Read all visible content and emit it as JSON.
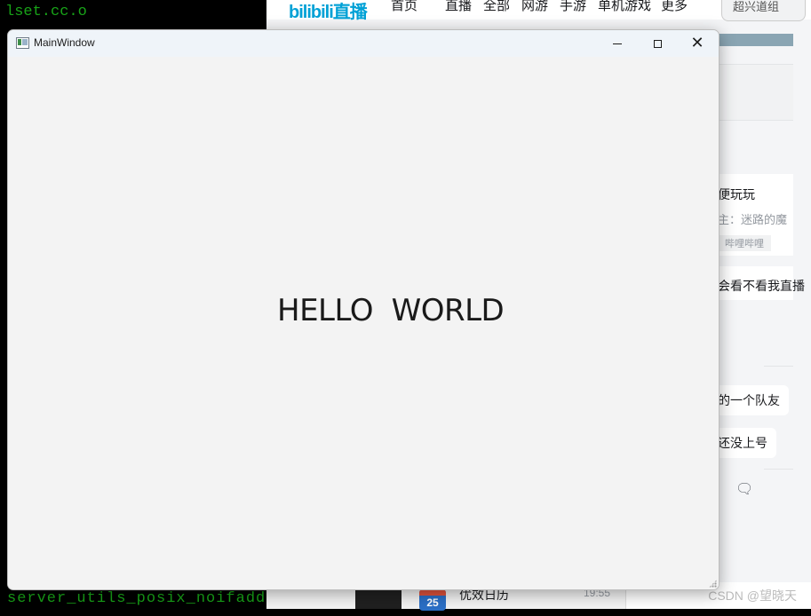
{
  "terminal": {
    "top_text": "lset.cc.o",
    "bottom_text": "server_utils_posix_noifaddrs.cc.o"
  },
  "bilibili": {
    "logo": "bilibili直播",
    "nav": [
      "首页",
      "直播",
      "全部",
      "网游",
      "手游",
      "单机游戏",
      "更多"
    ],
    "search": "超兴道组"
  },
  "right_panel": {
    "item1_title": "便玩玩",
    "item1_sub": "主：迷路的魔",
    "item1_tag": "哔哩哔哩",
    "item2": "会看不看我直播",
    "bubble1": "的一个队友",
    "bubble2": "还没上号"
  },
  "taskbar": {
    "app_name": "优效日历",
    "time": "19:55",
    "calendar_day": "25"
  },
  "watermark": "CSDN @望晓天",
  "window": {
    "title": "MainWindow",
    "content": "HELLO  WORLD"
  }
}
